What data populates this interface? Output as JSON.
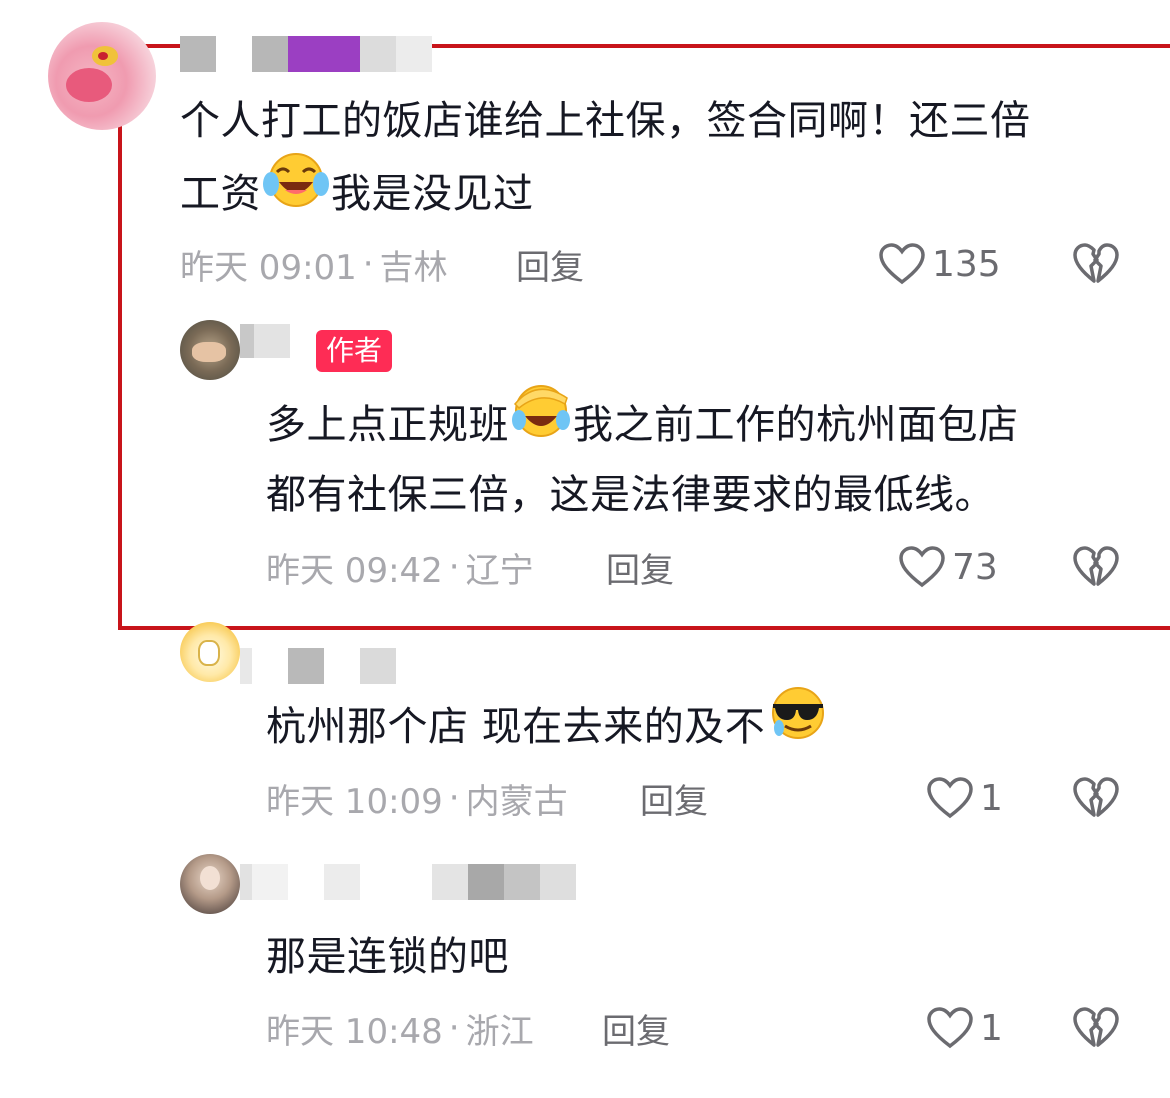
{
  "comments": [
    {
      "text_line1": "个人打工的饭店谁给上社保，签合同啊！还三倍",
      "text_line2_pre": "工资",
      "emoji": "face-with-tears-of-joy",
      "text_line2_post": "我是没见过",
      "time": "昨天 09:01",
      "separator": "·",
      "location": "吉林",
      "reply_label": "回复",
      "likes": "135"
    },
    {
      "badge": "作者",
      "text_line1_pre": "多上点正规班",
      "emoji": "face-with-tears-of-joy",
      "text_line1_post": "我之前工作的杭州面包店",
      "text_line2": "都有社保三倍，这是法律要求的最低线。",
      "time": "昨天 09:42",
      "separator": "·",
      "location": "辽宁",
      "reply_label": "回复",
      "likes": "73"
    },
    {
      "text_pre": "杭州那个店 现在去来的及不",
      "emoji": "smiling-face-with-sunglasses",
      "time": "昨天 10:09",
      "separator": "·",
      "location": "内蒙古",
      "reply_label": "回复",
      "likes": "1"
    },
    {
      "text": "那是连锁的吧",
      "time": "昨天 10:48",
      "separator": "·",
      "location": "浙江",
      "reply_label": "回复",
      "likes": "1"
    }
  ],
  "colors": {
    "highlight_border": "#c8141a",
    "badge_bg": "#fe2c55",
    "meta_text": "#a8a8ad"
  },
  "icons": {
    "like": "heart-outline-icon",
    "dislike": "broken-heart-icon"
  }
}
